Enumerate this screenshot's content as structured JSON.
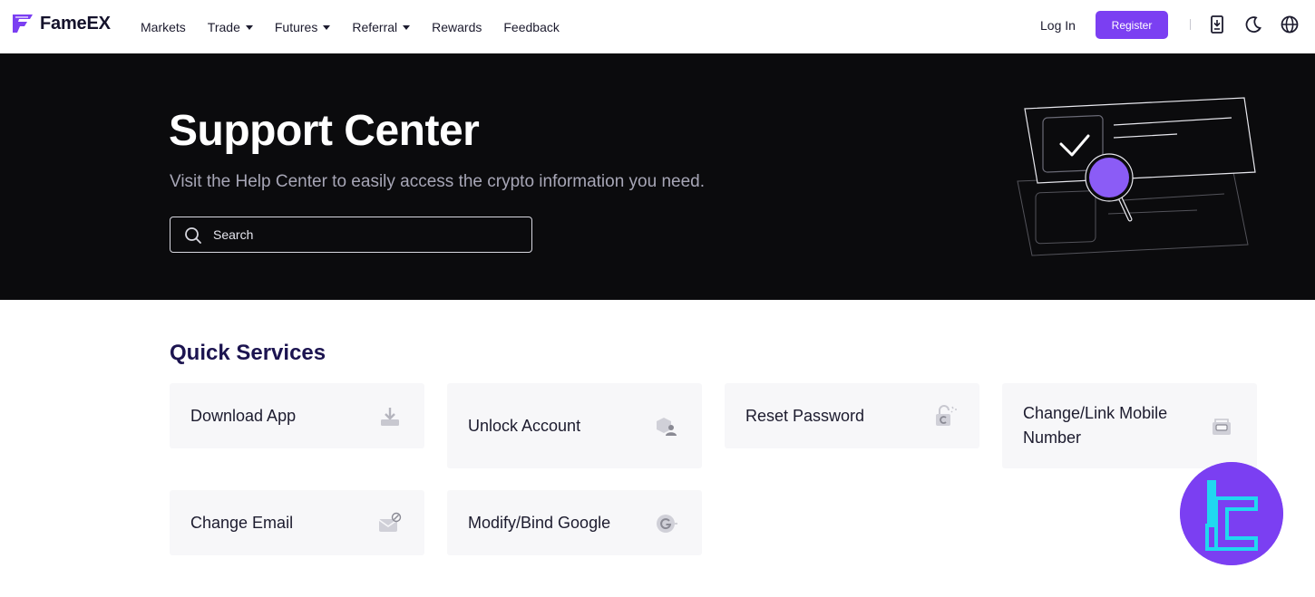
{
  "brand": {
    "name": "FameEX",
    "accent": "#7b3ff2"
  },
  "nav": {
    "items": [
      {
        "label": "Markets",
        "dropdown": false
      },
      {
        "label": "Trade",
        "dropdown": true
      },
      {
        "label": "Futures",
        "dropdown": true
      },
      {
        "label": "Referral",
        "dropdown": true
      },
      {
        "label": "Rewards",
        "dropdown": false
      },
      {
        "label": "Feedback",
        "dropdown": false
      }
    ],
    "login_label": "Log In",
    "register_label": "Register",
    "icons": [
      "download-app-icon",
      "dark-mode-moon-icon",
      "language-globe-icon"
    ]
  },
  "hero": {
    "title": "Support Center",
    "subtitle": "Visit the Help Center to easily access the crypto information you need.",
    "search_placeholder": "Search"
  },
  "quick_services": {
    "title": "Quick Services",
    "cards": [
      {
        "label": "Download App",
        "icon": "download-icon"
      },
      {
        "label": "Unlock Account",
        "icon": "unlock-account-icon"
      },
      {
        "label": "Reset Password",
        "icon": "reset-password-icon"
      },
      {
        "label": "Change/Link Mobile Number",
        "icon": "mobile-phone-icon"
      },
      {
        "label": "Change Email",
        "icon": "email-icon"
      },
      {
        "label": "Modify/Bind Google",
        "icon": "google-icon"
      }
    ]
  }
}
